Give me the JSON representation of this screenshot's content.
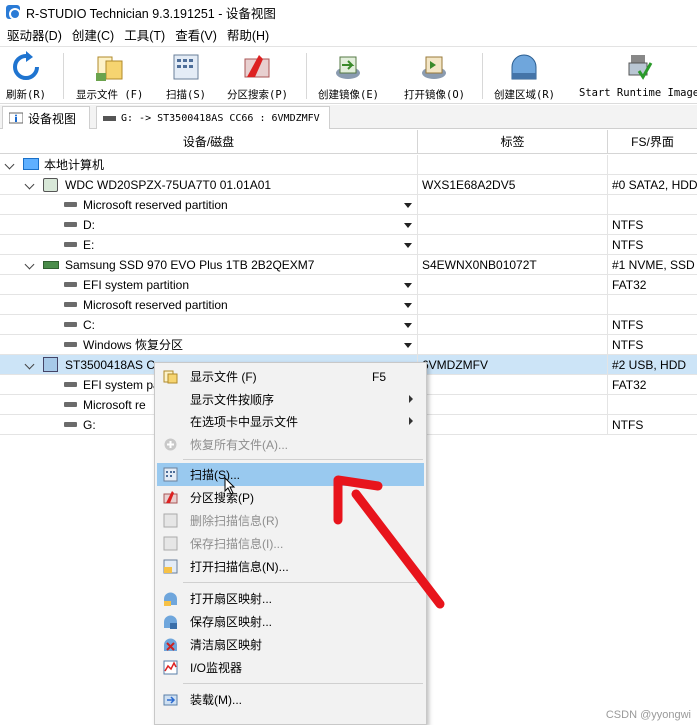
{
  "window": {
    "title": "R-STUDIO Technician 9.3.191251 - 设备视图"
  },
  "menu": [
    "驱动器(D)",
    "创建(C)",
    "工具(T)",
    "查看(V)",
    "帮助(H)"
  ],
  "toolbar": {
    "refresh": "刷新(R)",
    "show_files": "显示文件 (F)",
    "scan": "扫描(S)",
    "partition_search": "分区搜索(P)",
    "create_image": "创建镜像(E)",
    "open_image": "打开镜像(O)",
    "create_region": "创建区域(R)",
    "start_runtime": "Start Runtime Image"
  },
  "tabs": {
    "device_view": "设备视图",
    "drive_tab": "G: -> ST3500418AS CC66 : 6VMDZMFV"
  },
  "columns": {
    "device": "设备/磁盘",
    "label": "标签",
    "fs": "FS/界面"
  },
  "tree": {
    "root": "本地计算机",
    "disk1": {
      "name": "WDC WD20SPZX-75UA7T0 01.01A01",
      "label": "WXS1E68A2DV5",
      "fs": "#0 SATA2, HDD"
    },
    "disk1_parts": [
      {
        "name": "Microsoft reserved partition",
        "fs": ""
      },
      {
        "name": "D:",
        "fs": "NTFS"
      },
      {
        "name": "E:",
        "fs": "NTFS"
      }
    ],
    "disk2": {
      "name": "Samsung SSD 970 EVO Plus 1TB 2B2QEXM7",
      "label": "S4EWNX0NB01072T",
      "fs": "#1 NVME, SSD"
    },
    "disk2_parts": [
      {
        "name": "EFI system partition",
        "fs": "FAT32"
      },
      {
        "name": "Microsoft reserved partition",
        "fs": ""
      },
      {
        "name": "C:",
        "fs": "NTFS"
      },
      {
        "name": "Windows 恢复分区",
        "fs": "NTFS"
      }
    ],
    "disk3": {
      "name": "ST3500418AS C",
      "label": "6VMDZMFV",
      "fs": "#2 USB, HDD"
    },
    "disk3_parts": [
      {
        "name": "EFI system partition",
        "fs": "FAT32"
      },
      {
        "name": "Microsoft re",
        "fs": ""
      },
      {
        "name": "G:",
        "fs": "NTFS"
      }
    ]
  },
  "context_menu": {
    "show_files": "显示文件 (F)",
    "show_files_shortcut": "F5",
    "show_files_order": "显示文件按顺序",
    "show_in_tab": "在选项卡中显示文件",
    "recover_all": "恢复所有文件(A)...",
    "scan": "扫描(S)...",
    "partition_search": "分区搜索(P)",
    "delete_scan": "删除扫描信息(R)",
    "save_scan": "保存扫描信息(I)...",
    "open_scan": "打开扫描信息(N)...",
    "open_sector_map": "打开扇区映射...",
    "save_sector_map": "保存扇区映射...",
    "clear_sector_map": "清洁扇区映射",
    "io_monitor": "I/O监视器",
    "mount": "装载(M)..."
  },
  "watermark": "CSDN @yyongwi",
  "colors": {
    "selected_row": "#cce4f7",
    "menu_highlight": "#99c9ef",
    "arrow": "#e8141c"
  }
}
